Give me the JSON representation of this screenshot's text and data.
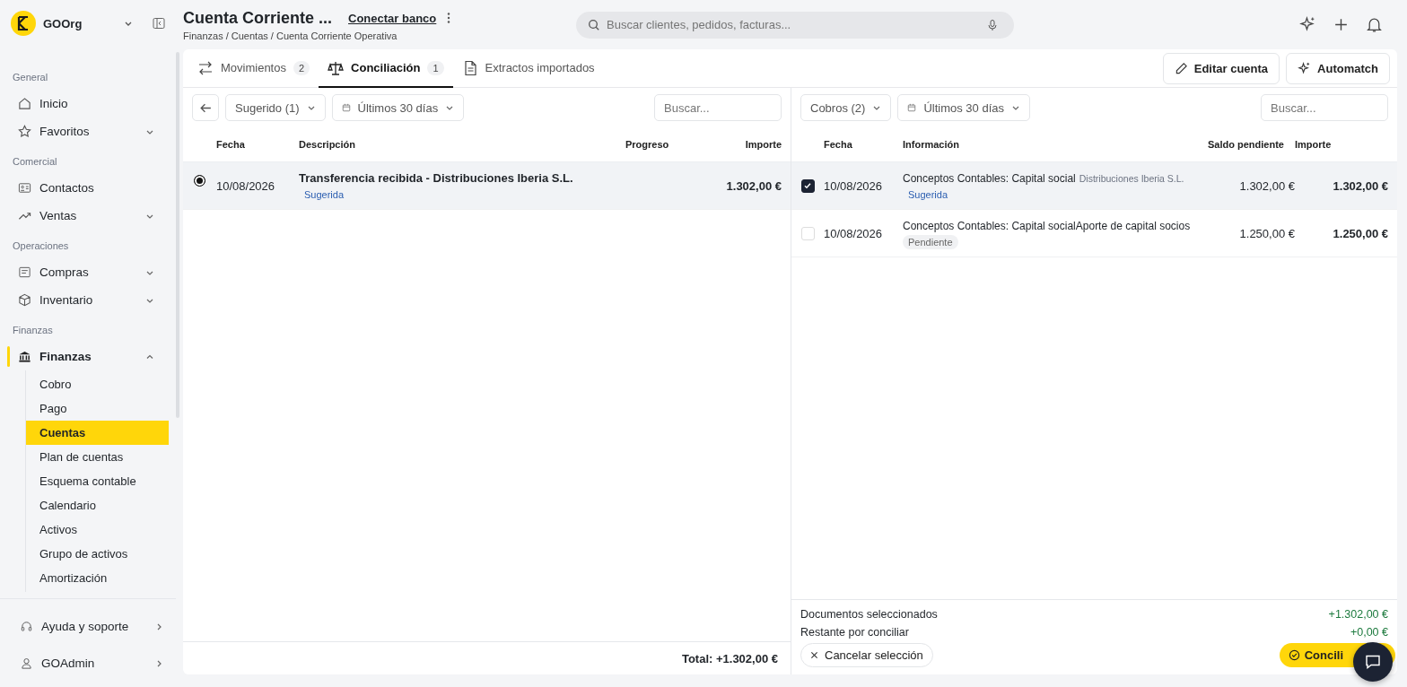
{
  "org": {
    "name": "GOOrg"
  },
  "header": {
    "title": "Cuenta Corriente ...",
    "link": "Conectar banco",
    "breadcrumb": "Finanzas / Cuentas / Cuenta Corriente Operativa",
    "search": {
      "placeholder": "Buscar clientes, pedidos, facturas..."
    }
  },
  "sidebar": {
    "sections": [
      {
        "label": "General",
        "items": [
          {
            "label": "Inicio"
          },
          {
            "label": "Favoritos",
            "expanded": false
          }
        ]
      },
      {
        "label": "Comercial",
        "items": [
          {
            "label": "Contactos"
          },
          {
            "label": "Ventas",
            "expanded": false
          }
        ]
      },
      {
        "label": "Operaciones",
        "items": [
          {
            "label": "Compras",
            "expanded": false
          },
          {
            "label": "Inventario",
            "expanded": false
          }
        ]
      },
      {
        "label": "Finanzas",
        "items": [
          {
            "label": "Finanzas",
            "expanded": true,
            "children": [
              {
                "label": "Cobro",
                "selected": false
              },
              {
                "label": "Pago",
                "selected": false
              },
              {
                "label": "Cuentas",
                "selected": true
              },
              {
                "label": "Plan de cuentas",
                "selected": false
              },
              {
                "label": "Esquema contable",
                "selected": false
              },
              {
                "label": "Calendario",
                "selected": false
              },
              {
                "label": "Activos",
                "selected": false
              },
              {
                "label": "Grupo de activos",
                "selected": false
              },
              {
                "label": "Amortización",
                "selected": false
              }
            ]
          }
        ]
      }
    ],
    "bottom": [
      {
        "label": "Ayuda y soporte"
      },
      {
        "label": "GOAdmin"
      }
    ]
  },
  "tabs": [
    {
      "label": "Movimientos",
      "count": "2",
      "selected": false
    },
    {
      "label": "Conciliación",
      "count": "1",
      "selected": true
    },
    {
      "label": "Extractos importados",
      "selected": false
    }
  ],
  "actions": [
    "Editar cuenta",
    "Automatch"
  ],
  "left": {
    "filters": [
      "Sugerido (1)",
      "Últimos 30 días"
    ],
    "search": {
      "placeholder": "Buscar..."
    },
    "columns": [
      "Fecha",
      "Descripción",
      "Progreso",
      "Importe"
    ],
    "rows": [
      {
        "selected": true,
        "date": "10/08/2026",
        "description": "Transferencia recibida - Distribuciones Iberia S.L.",
        "badge": {
          "label": "Sugerida",
          "kind": "suggested"
        },
        "amount": "1.302,00 €"
      }
    ],
    "total": "Total: +1.302,00 €"
  },
  "right": {
    "filters": [
      "Cobros (2)",
      "Últimos 30 días"
    ],
    "search": {
      "placeholder": "Buscar..."
    },
    "columns": [
      "Fecha",
      "Información",
      "Saldo pendiente",
      "Importe"
    ],
    "rows": [
      {
        "checked": true,
        "date": "10/08/2026",
        "info": "Conceptos Contables: Capital social",
        "info_secondary": "Distribuciones Iberia S.L.",
        "badge": {
          "label": "Sugerida",
          "kind": "suggested"
        },
        "balance": "1.302,00 €",
        "amount": "1.302,00 €"
      },
      {
        "checked": false,
        "date": "10/08/2026",
        "info": "Conceptos Contables: Capital socialAporte de capital socios",
        "badge": {
          "label": "Pendiente",
          "kind": "pending"
        },
        "balance": "1.250,00 €",
        "amount": "1.250,00 €"
      }
    ],
    "summary": [
      {
        "label": "Documentos seleccionados",
        "value": "+1.302,00 €"
      },
      {
        "label": "Restante por conciliar",
        "value": "+0,00 €"
      }
    ],
    "cancel": "Cancelar selección",
    "confirm": "Concili"
  }
}
